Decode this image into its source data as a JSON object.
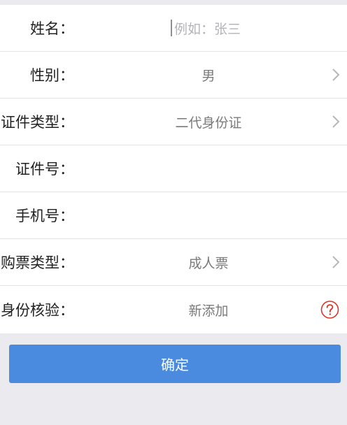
{
  "form": {
    "name": {
      "label": "姓名：",
      "placeholder": "例如：张三"
    },
    "gender": {
      "label": "性别：",
      "value": "男"
    },
    "id_type": {
      "label": "证件类型：",
      "value": "二代身份证"
    },
    "id_number": {
      "label": "证件号：",
      "value": ""
    },
    "phone": {
      "label": "手机号：",
      "value": ""
    },
    "ticket_type": {
      "label": "购票类型：",
      "value": "成人票"
    },
    "identity_check": {
      "label": "身份核验：",
      "value": "新添加"
    }
  },
  "confirm_label": "确定",
  "colors": {
    "background": "#ebebef",
    "accent": "#4a8be0",
    "help_icon": "#d9362b",
    "chevron": "#b7b7bb"
  }
}
